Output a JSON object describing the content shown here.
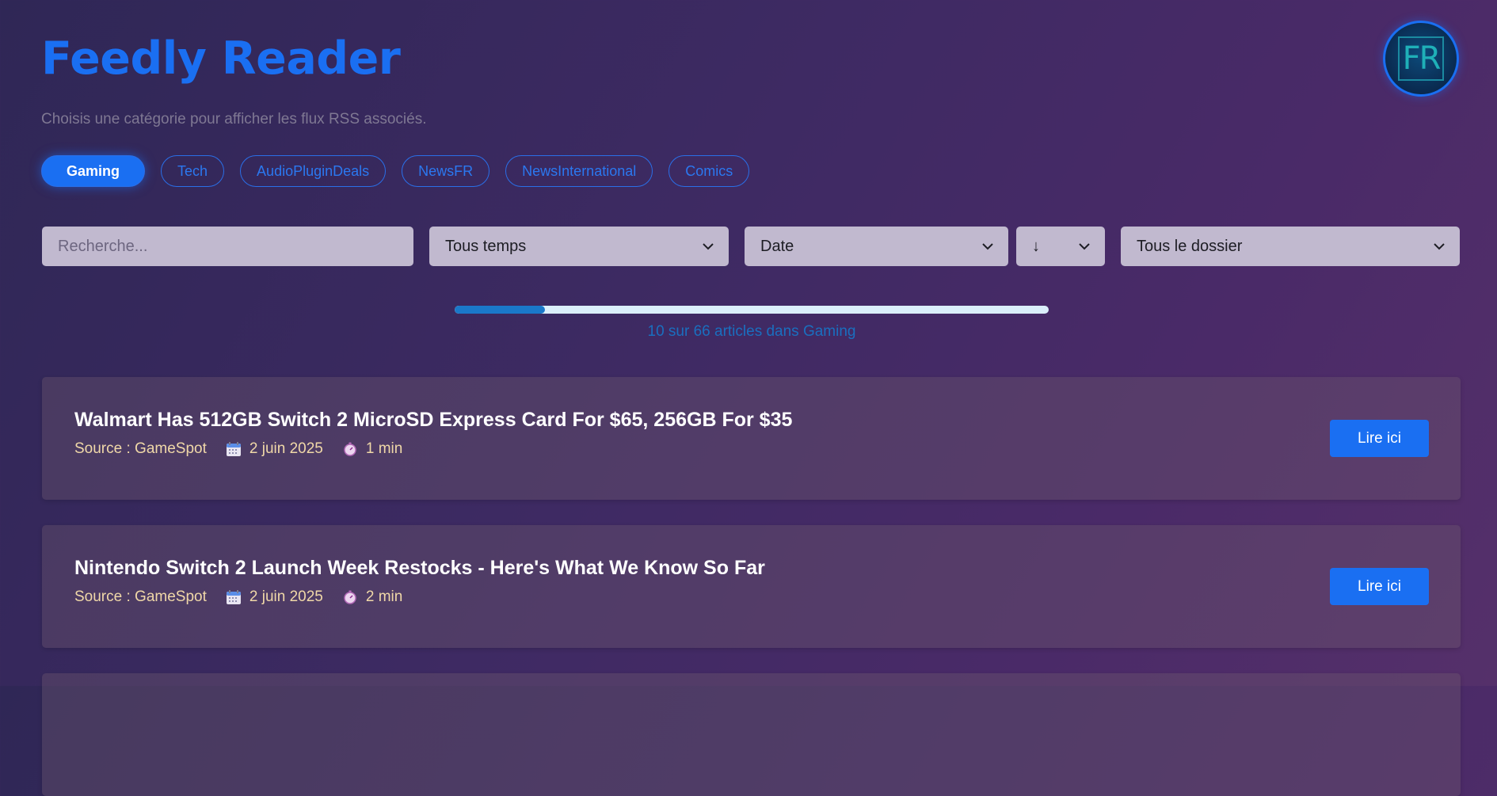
{
  "app": {
    "title": "Feedly Reader",
    "subtitle": "Choisis une catégorie pour afficher les flux RSS associés.",
    "logo_text": "FR"
  },
  "categories": {
    "active": "Gaming",
    "items": [
      "Gaming",
      "Tech",
      "AudioPluginDeals",
      "NewsFR",
      "NewsInternational",
      "Comics"
    ]
  },
  "filters": {
    "search_placeholder": "Recherche...",
    "time_value": "Tous temps",
    "sort_value": "Date",
    "order_value": "↓",
    "folder_value": "Tous le dossier"
  },
  "progress": {
    "loaded": 10,
    "total": 66,
    "fraction": 0.1515,
    "text": "10 sur 66 articles dans Gaming"
  },
  "articles": [
    {
      "title": "Walmart Has 512GB Switch 2 MicroSD Express Card For $65, 256GB For $35",
      "source": "Source : GameSpot",
      "date": "2 juin 2025",
      "read_time": "1 min",
      "button": "Lire ici"
    },
    {
      "title": "Nintendo Switch 2 Launch Week Restocks - Here's What We Know So Far",
      "source": "Source : GameSpot",
      "date": "2 juin 2025",
      "read_time": "2 min",
      "button": "Lire ici"
    }
  ],
  "icons": {
    "date": "calendar-icon",
    "read_time": "stopwatch-icon",
    "dropdown": "chevron-down-icon"
  },
  "colors": {
    "accent": "#1a6ff2",
    "meta": "#f0d8a8",
    "progress_fill": "#1a78c9"
  }
}
